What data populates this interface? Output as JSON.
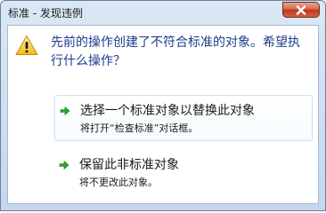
{
  "window": {
    "title": "标准 - 发现违例"
  },
  "dialog": {
    "main_instruction": "先前的操作创建了不符合标准的对象。希望执行什么操作？",
    "icon": "warning-icon"
  },
  "options": [
    {
      "label": "选择一个标准对象以替换此对象",
      "note": "将打开“检查标准”对话框。",
      "icon": "green-arrow-icon"
    },
    {
      "label": "保留此非标准对象",
      "note": "将不更改此对象。",
      "icon": "green-arrow-icon"
    }
  ],
  "colors": {
    "instruction_text": "#1f3c8c",
    "arrow": "#2aa52a",
    "close_button": "#c2361c"
  }
}
